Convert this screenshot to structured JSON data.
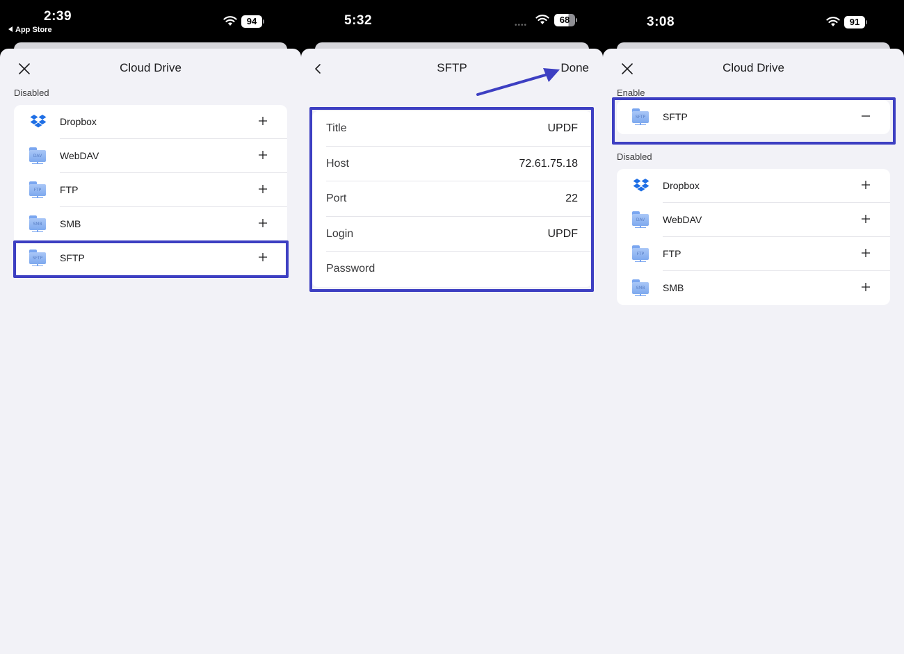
{
  "accent_color": "#3d3fc2",
  "screens": [
    {
      "status": {
        "time": "2:39",
        "back_app": "App Store",
        "battery": "94"
      },
      "title": "Cloud Drive",
      "disabled_label": "Disabled",
      "items": [
        {
          "label": "Dropbox",
          "icon": "dropbox-icon"
        },
        {
          "label": "WebDAV",
          "icon": "folder-icon",
          "tag": "DAV"
        },
        {
          "label": "FTP",
          "icon": "folder-icon",
          "tag": "FTP"
        },
        {
          "label": "SMB",
          "icon": "folder-icon",
          "tag": "SMB"
        },
        {
          "label": "SFTP",
          "icon": "folder-icon",
          "tag": "SFTP"
        }
      ]
    },
    {
      "status": {
        "time": "5:32",
        "battery": "68"
      },
      "title": "SFTP",
      "done_label": "Done",
      "fields": [
        {
          "key": "Title",
          "value": "UPDF"
        },
        {
          "key": "Host",
          "value": "72.61.75.18"
        },
        {
          "key": "Port",
          "value": "22"
        },
        {
          "key": "Login",
          "value": "UPDF"
        },
        {
          "key": "Password",
          "value": ""
        }
      ]
    },
    {
      "status": {
        "time": "3:08",
        "battery": "91"
      },
      "title": "Cloud Drive",
      "enable_label": "Enable",
      "enabled_items": [
        {
          "label": "SFTP",
          "icon": "folder-icon",
          "tag": "SFTP"
        }
      ],
      "disabled_label": "Disabled",
      "items": [
        {
          "label": "Dropbox",
          "icon": "dropbox-icon"
        },
        {
          "label": "WebDAV",
          "icon": "folder-icon",
          "tag": "DAV"
        },
        {
          "label": "FTP",
          "icon": "folder-icon",
          "tag": "FTP"
        },
        {
          "label": "SMB",
          "icon": "folder-icon",
          "tag": "SMB"
        }
      ]
    }
  ]
}
